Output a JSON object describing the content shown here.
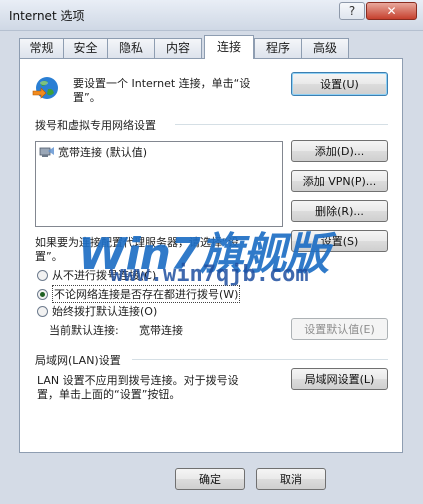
{
  "window": {
    "title": "Internet 选项",
    "help_glyph": "?",
    "close_glyph": "✕"
  },
  "tabs": [
    {
      "label": "常规"
    },
    {
      "label": "安全"
    },
    {
      "label": "隐私"
    },
    {
      "label": "内容"
    },
    {
      "label": "连接",
      "active": true
    },
    {
      "label": "程序"
    },
    {
      "label": "高级"
    }
  ],
  "setup": {
    "text_line1": "要设置一个 Internet 连接，单击“设",
    "text_line2": "置”。",
    "button": "设置(U)"
  },
  "dialup": {
    "section_title": "拨号和虚拟专用网络设置",
    "connections": [
      {
        "label": "宽带连接 (默认值)"
      }
    ],
    "add_button": "添加(D)...",
    "add_vpn_button": "添加 VPN(P)...",
    "delete_button": "删除(R)...",
    "proxy_text_line1": "如果要为连接配置代理服务器，请选择“设",
    "proxy_text_line2": "置”。",
    "settings_button": "设置(S)",
    "radio_never": "从不进行拨号连接(C)",
    "radio_when_no_network": "不论网络连接是否存在都进行拨号(W)",
    "radio_always": "始终拨打默认连接(O)",
    "current_default_label": "当前默认连接:",
    "current_default_value": "宽带连接",
    "set_default_button": "设置默认值(E)"
  },
  "lan": {
    "section_title": "局域网(LAN)设置",
    "text_line1": "LAN 设置不应用到拨号连接。对于拨号设",
    "text_line2": "置，单击上面的“设置”按钮。",
    "button": "局域网设置(L)"
  },
  "footer": {
    "ok_button": "确定",
    "cancel_button": "取消"
  },
  "watermark": {
    "brand": "Win7旗舰版",
    "url": "www.win7qjb.com"
  },
  "colors": {
    "globe_blue": "#2a7fd4",
    "globe_green": "#3aa03a",
    "watermark_blue": "#1f6fc5"
  }
}
